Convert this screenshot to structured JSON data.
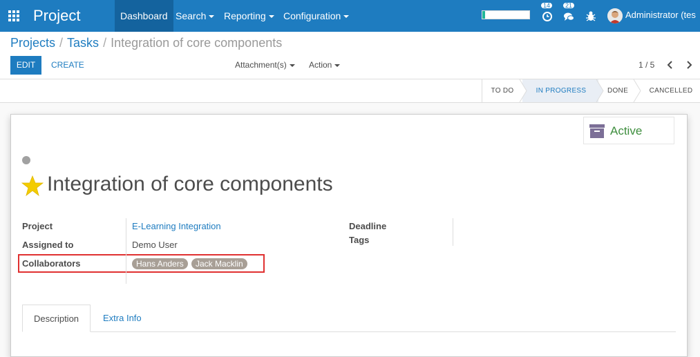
{
  "navbar": {
    "app_title": "Project",
    "menu": [
      {
        "label": "Dashboard"
      },
      {
        "label": "Search"
      },
      {
        "label": "Reporting"
      },
      {
        "label": "Configuration"
      }
    ],
    "activity_count": "14",
    "messages_count": "21",
    "user_name": "Administrator (tes"
  },
  "control_panel": {
    "breadcrumb": {
      "projects": "Projects",
      "tasks": "Tasks",
      "current": "Integration of core components"
    },
    "edit_label": "EDIT",
    "create_label": "CREATE",
    "attachment_label": "Attachment(s)",
    "action_label": "Action",
    "pager": "1 / 5"
  },
  "statusbar": {
    "stages": [
      {
        "label": "TO DO",
        "active": false
      },
      {
        "label": "IN PROGRESS",
        "active": true
      },
      {
        "label": "DONE",
        "active": false
      },
      {
        "label": "CANCELLED",
        "active": false
      }
    ]
  },
  "form": {
    "active_label": "Active",
    "task_title": "Integration of core components",
    "fields": {
      "project_label": "Project",
      "project_value": "E-Learning Integration",
      "assigned_label": "Assigned to",
      "assigned_value": "Demo User",
      "collaborators_label": "Collaborators",
      "collaborators": [
        "Hans Anders",
        "Jack Macklin"
      ],
      "deadline_label": "Deadline",
      "tags_label": "Tags"
    },
    "tabs": [
      {
        "label": "Description"
      },
      {
        "label": "Extra Info"
      }
    ]
  },
  "colors": {
    "navbar": "#1e7cc0",
    "active_stage_bg": "#e9eef5",
    "active_text": "#3e8e3e",
    "star": "#f3cc00",
    "tag_bg": "#a89f96",
    "highlight": "#e03030"
  }
}
